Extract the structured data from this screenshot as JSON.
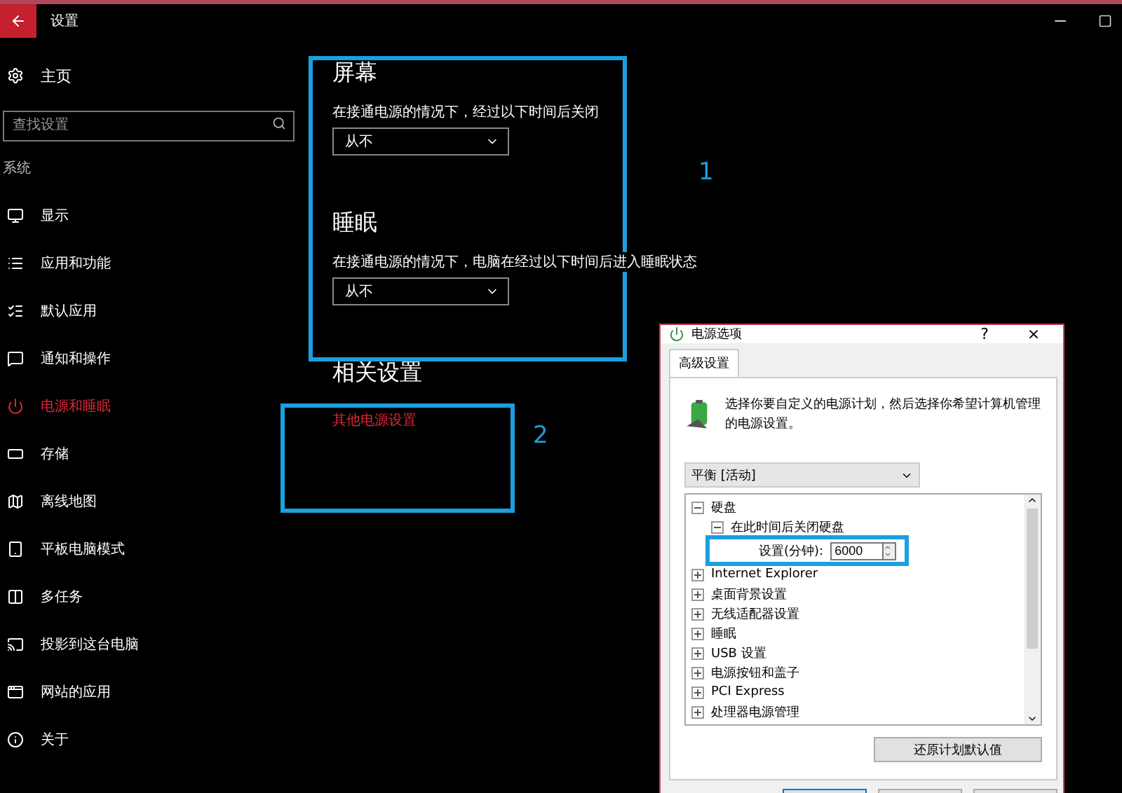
{
  "window": {
    "title": "设置"
  },
  "sidebar": {
    "home": "主页",
    "search": {
      "placeholder": "查找设置"
    },
    "section": "系统",
    "items": [
      {
        "label": "显示",
        "selected": false
      },
      {
        "label": "应用和功能",
        "selected": false
      },
      {
        "label": "默认应用",
        "selected": false
      },
      {
        "label": "通知和操作",
        "selected": false
      },
      {
        "label": "电源和睡眠",
        "selected": true
      },
      {
        "label": "存储",
        "selected": false
      },
      {
        "label": "离线地图",
        "selected": false
      },
      {
        "label": "平板电脑模式",
        "selected": false
      },
      {
        "label": "多任务",
        "selected": false
      },
      {
        "label": "投影到这台电脑",
        "selected": false
      },
      {
        "label": "网站的应用",
        "selected": false
      },
      {
        "label": "关于",
        "selected": false
      }
    ]
  },
  "sections": [
    {
      "heading": "屏幕",
      "description": "在接通电源的情况下，经过以下时间后关闭",
      "value": "从不"
    },
    {
      "heading": "睡眠",
      "description": "在接通电源的情况下，电脑在经过以下时间后进入睡眠状态",
      "value": "从不"
    }
  ],
  "related": {
    "heading": "相关设置",
    "link": "其他电源设置"
  },
  "annotations": [
    "1",
    "2"
  ],
  "dialog": {
    "title": "电源选项",
    "help": "?",
    "close": "×",
    "tab": "高级设置",
    "description": "选择你要自定义的电源计划，然后选择你希望计算机管理的电源设置。",
    "plan": "平衡 [活动]",
    "tree": [
      {
        "label": "硬盘",
        "expanded": true,
        "children": [
          {
            "label": "在此时间后关闭硬盘",
            "expanded": true,
            "children": [
              {
                "kind": "spin",
                "label": "设置(分钟):",
                "value": "6000"
              }
            ]
          }
        ]
      },
      {
        "label": "Internet Explorer",
        "expanded": false
      },
      {
        "label": "桌面背景设置",
        "expanded": false
      },
      {
        "label": "无线适配器设置",
        "expanded": false
      },
      {
        "label": "睡眠",
        "expanded": false
      },
      {
        "label": "USB 设置",
        "expanded": false
      },
      {
        "label": "电源按钮和盖子",
        "expanded": false
      },
      {
        "label": "PCI Express",
        "expanded": false
      },
      {
        "label": "处理器电源管理",
        "expanded": false
      }
    ],
    "restore": "还原计划默认值"
  }
}
